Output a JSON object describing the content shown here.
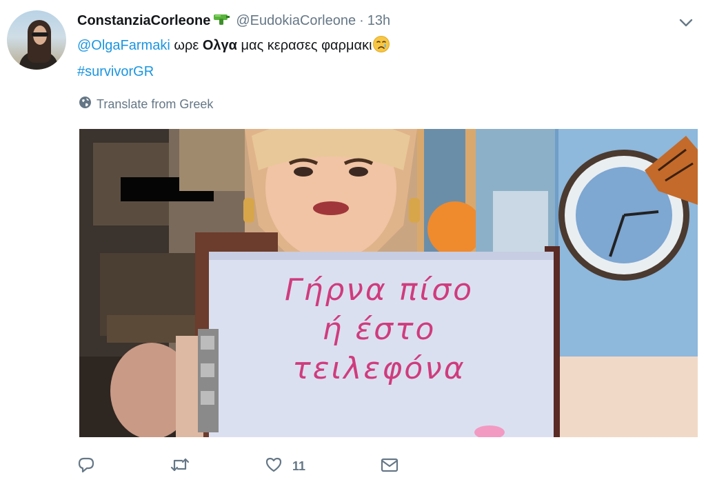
{
  "tweet": {
    "author": {
      "display_name": "ConstanziaCorleone",
      "name_emoji": "water-pistol-icon",
      "handle": "@EudokiaCorleone",
      "time": "13h"
    },
    "separator": "·",
    "text": {
      "mention": "@OlgaFarmaki",
      "word1": "ωρε",
      "bold_word": "Ολγα",
      "rest": "μας κερασες φαρμακι",
      "emoji": "crying-face-icon",
      "hashtag": "#survivorGR"
    },
    "translate_label": "Translate from Greek",
    "media": {
      "sign_lines": [
        "Γήρνα πίσο",
        "ή έστο",
        "τειλεφόνα"
      ]
    },
    "actions": {
      "reply_icon": "reply-icon",
      "retweet_icon": "retweet-icon",
      "like_icon": "heart-icon",
      "like_count": "11",
      "dm_icon": "envelope-icon"
    }
  },
  "colors": {
    "link": "#1b95e0",
    "secondary": "#657786",
    "text": "#14171a",
    "sign_ink": "#cf3c7e"
  }
}
